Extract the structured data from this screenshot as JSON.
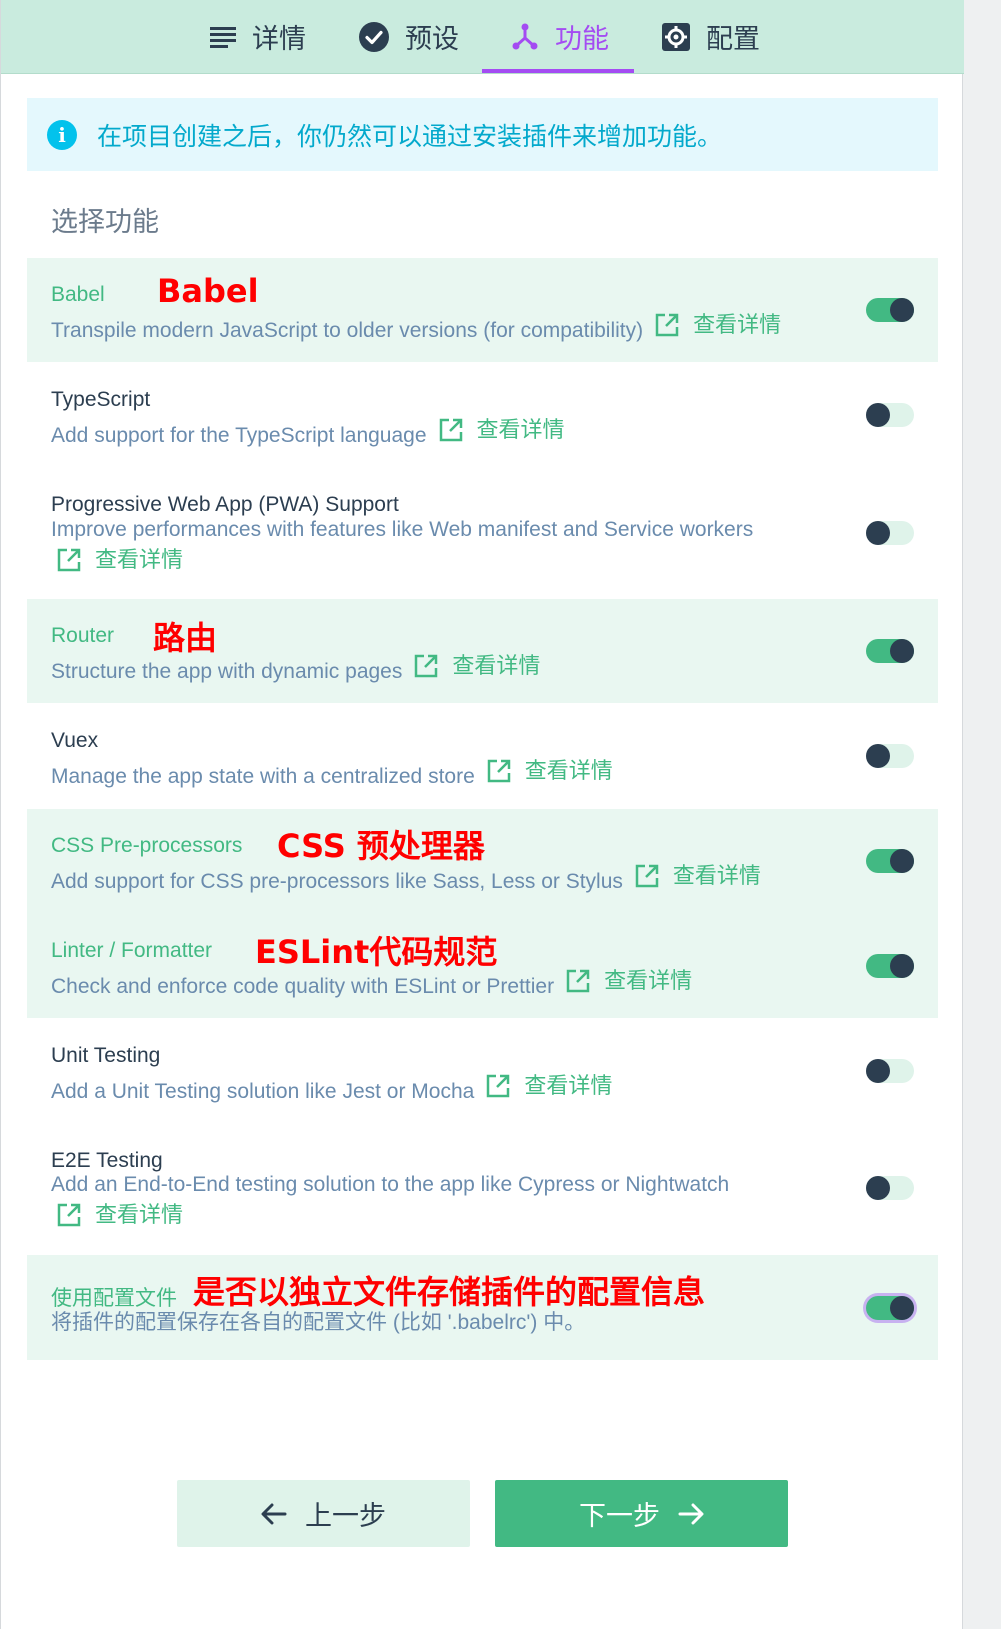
{
  "tabs": [
    {
      "label": "详情",
      "icon": "list-icon",
      "active": false
    },
    {
      "label": "预设",
      "icon": "check-circle-icon",
      "active": false
    },
    {
      "label": "功能",
      "icon": "fork-icon",
      "active": true
    },
    {
      "label": "配置",
      "icon": "gear-icon",
      "active": false
    }
  ],
  "info": {
    "icon": "info-icon",
    "text": "在项目创建之后，你仍然可以通过安装插件来增加功能。"
  },
  "section_title": "选择功能",
  "more_label": "查看详情",
  "features": [
    {
      "name": "Babel",
      "description": "Transpile modern JavaScript to older versions (for compatibility)",
      "enabled": true,
      "annotation": "Babel"
    },
    {
      "name": "TypeScript",
      "description": "Add support for the TypeScript language",
      "enabled": false
    },
    {
      "name": "Progressive Web App (PWA) Support",
      "description": "Improve performances with features like Web manifest and Service workers",
      "enabled": false
    },
    {
      "name": "Router",
      "description": "Structure the app with dynamic pages",
      "enabled": true,
      "annotation": "路由"
    },
    {
      "name": "Vuex",
      "description": "Manage the app state with a centralized store",
      "enabled": false
    },
    {
      "name": "CSS Pre-processors",
      "description": "Add support for CSS pre-processors like Sass, Less or Stylus",
      "enabled": true,
      "annotation": "CSS 预处理器"
    },
    {
      "name": "Linter / Formatter",
      "description": "Check and enforce code quality with ESLint or Prettier",
      "enabled": true,
      "annotation": "ESLint代码规范"
    },
    {
      "name": "Unit Testing",
      "description": "Add a Unit Testing solution like Jest or Mocha",
      "enabled": false
    },
    {
      "name": "E2E Testing",
      "description": "Add an End-to-End testing solution to the app like Cypress or Nightwatch",
      "enabled": false
    }
  ],
  "config_file": {
    "name": "使用配置文件",
    "description": "将插件的配置保存在各自的配置文件 (比如 '.babelrc') 中。",
    "enabled": true,
    "annotation": "是否以独立文件存储插件的配置信息"
  },
  "buttons": {
    "prev_label": "上一步",
    "next_label": "下一步"
  },
  "colors": {
    "accent": "#42b983",
    "active_tab": "#a44cf2",
    "annotation": "#ff0000",
    "tab_bar": "#c9ebde"
  }
}
